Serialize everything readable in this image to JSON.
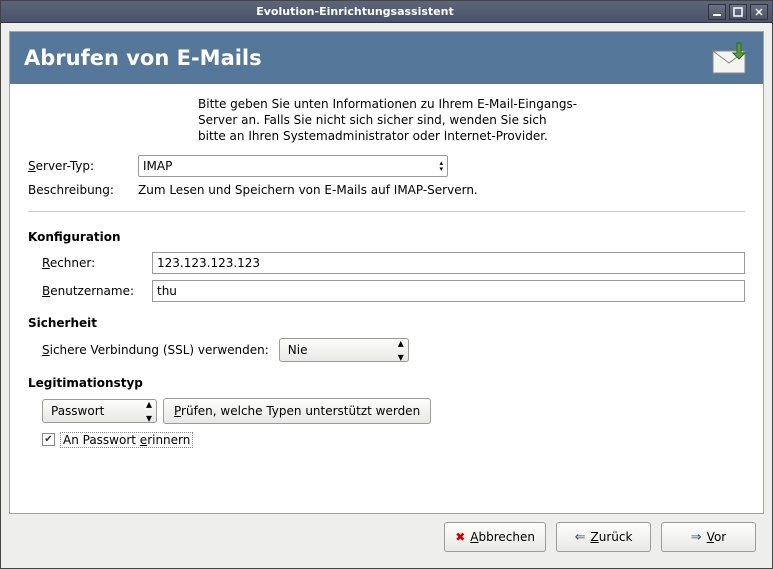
{
  "window": {
    "title": "Evolution-Einrichtungsassistent"
  },
  "header": {
    "title": "Abrufen von E-Mails"
  },
  "intro": {
    "line1": "Bitte geben Sie unten Informationen zu Ihrem E-Mail-Eingangs-",
    "line2": "Server an. Falls Sie nicht sich sicher sind, wenden Sie sich",
    "line3": "bitte an Ihren Systemadministrator oder Internet-Provider."
  },
  "serverType": {
    "label_pre": "S",
    "label_rest": "erver-Typ:",
    "value": "IMAP"
  },
  "description": {
    "label": "Beschreibung:",
    "value": "Zum Lesen und Speichern von E-Mails auf IMAP-Servern."
  },
  "config": {
    "title": "Konfiguration",
    "host": {
      "label_pre": "R",
      "label_rest": "echner:",
      "value": "123.123.123.123"
    },
    "user": {
      "label_pre": "B",
      "label_rest": "enutzername:",
      "value": "thu"
    }
  },
  "security": {
    "title": "Sicherheit",
    "ssl": {
      "label_pre": "S",
      "label_rest": "ichere Verbindung (SSL) verwenden:",
      "value": "Nie"
    }
  },
  "auth": {
    "title": "Legitimationstyp",
    "type": "Passwort",
    "check_btn_pre": "P",
    "check_btn_rest": "rüfen, welche Typen unterstützt werden",
    "remember_pre": "An Passwort ",
    "remember_u": "e",
    "remember_rest": "rinnern"
  },
  "buttons": {
    "cancel_pre": "A",
    "cancel_rest": "bbrechen",
    "back_pre": "Z",
    "back_rest": "urück",
    "next_pre": "V",
    "next_rest": "or"
  }
}
